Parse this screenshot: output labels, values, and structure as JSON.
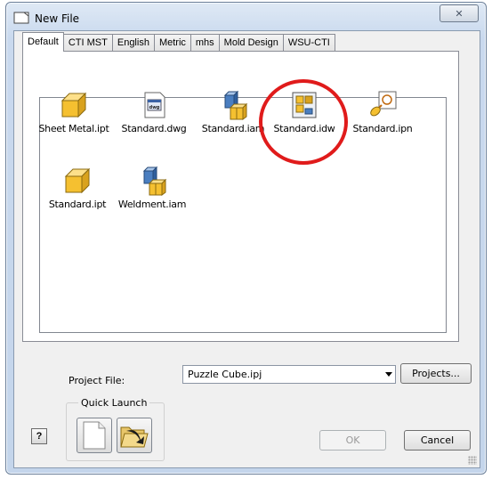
{
  "window": {
    "title": "New File",
    "close_glyph": "✕"
  },
  "tabs": [
    {
      "label": "Default",
      "active": true
    },
    {
      "label": "CTI MST",
      "active": false
    },
    {
      "label": "English",
      "active": false
    },
    {
      "label": "Metric",
      "active": false
    },
    {
      "label": "mhs",
      "active": false
    },
    {
      "label": "Mold Design",
      "active": false
    },
    {
      "label": "WSU-CTI",
      "active": false
    }
  ],
  "templates": [
    {
      "label": "Sheet Metal.ipt",
      "icon": "part-cube-icon"
    },
    {
      "label": "Standard.dwg",
      "icon": "drawing-dwg-icon"
    },
    {
      "label": "Standard.iam",
      "icon": "assembly-icon"
    },
    {
      "label": "Standard.idw",
      "icon": "drawing-idw-icon"
    },
    {
      "label": "Standard.ipn",
      "icon": "presentation-icon"
    },
    {
      "label": "Standard.ipt",
      "icon": "part-cube-icon"
    },
    {
      "label": "Weldment.iam",
      "icon": "assembly-icon"
    }
  ],
  "project": {
    "label": "Project File:",
    "value": "Puzzle Cube.ipj",
    "projects_button": "Projects..."
  },
  "quick_launch": {
    "caption": "Quick Launch",
    "buttons": [
      {
        "icon": "blank-document-icon"
      },
      {
        "icon": "open-folder-icon"
      }
    ]
  },
  "footer": {
    "help_glyph": "?",
    "ok_label": "OK",
    "cancel_label": "Cancel"
  },
  "colors": {
    "highlight_ring": "#e01b1b",
    "part_yellow": "#f5c030",
    "assembly_blue": "#4a7ec0"
  }
}
